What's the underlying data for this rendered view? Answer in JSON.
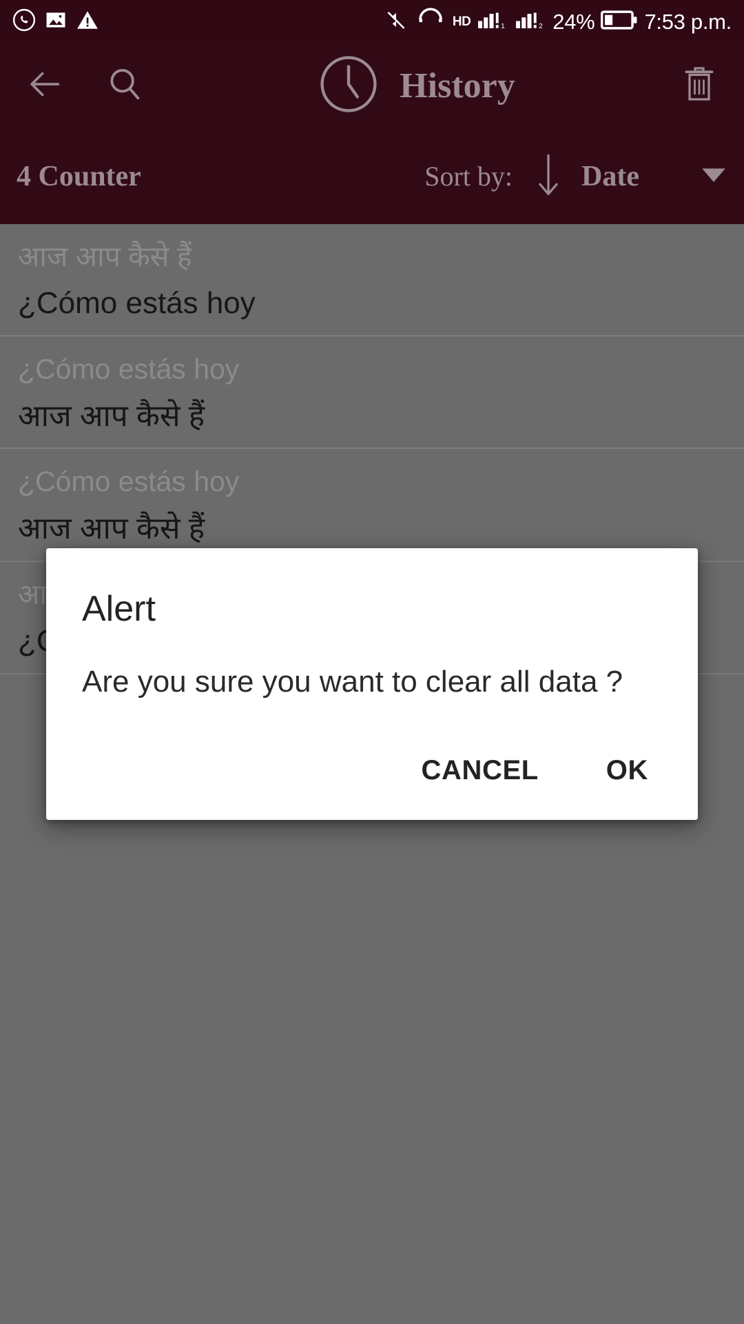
{
  "theme": {
    "status_bar_bg": "#300914",
    "app_bar_bg": "#310a16",
    "app_bar_text": "#9c8b90",
    "scrim_bg": "#6b6b6b",
    "dialog_bg": "#ffffff",
    "list_source_text": "#8b8b8b",
    "list_target_text": "#161616"
  },
  "status_bar": {
    "left_icons": [
      "whatsapp-icon",
      "image-icon",
      "warning-icon"
    ],
    "right_icons": [
      "mute-icon",
      "hd-voice-icon",
      "signal-sim1-icon",
      "signal-sim2-icon",
      "battery-icon"
    ],
    "hd_label": "HD",
    "battery_percent": "24%",
    "time": "7:53 p.m."
  },
  "app_bar": {
    "back_icon": "arrow-back-icon",
    "search_icon": "search-icon",
    "clock_icon": "clock-icon",
    "title": "History",
    "delete_icon": "trash-icon"
  },
  "sort_bar": {
    "counter_label": "4 Counter",
    "sort_by_label": "Sort by:",
    "sort_direction_icon": "arrow-down-icon",
    "sort_value": "Date",
    "dropdown_icon": "caret-down-icon"
  },
  "history": {
    "items": [
      {
        "source": "आज आप कैसे हैं",
        "target": "¿Cómo estás hoy"
      },
      {
        "source": "¿Cómo estás hoy",
        "target": "आज आप कैसे हैं"
      },
      {
        "source": "¿Cómo estás hoy",
        "target": "आज आप कैसे हैं"
      },
      {
        "source": "आज आप कैसे हैं",
        "target": "¿Cómo estás hoy"
      }
    ]
  },
  "dialog": {
    "title": "Alert",
    "message": "Are you sure you want to clear all data ?",
    "cancel_label": "CANCEL",
    "ok_label": "OK"
  }
}
